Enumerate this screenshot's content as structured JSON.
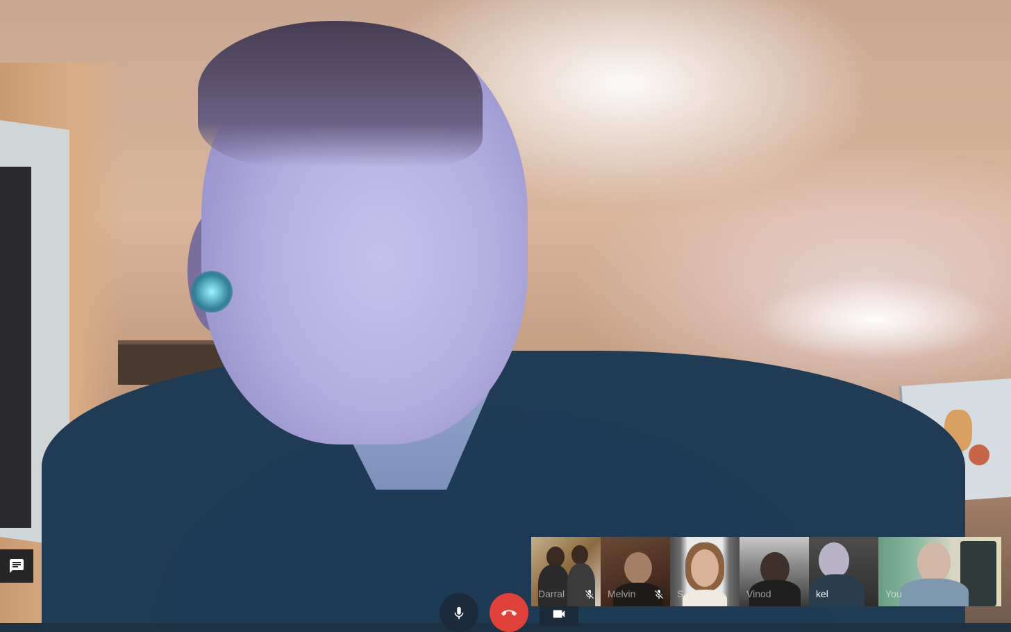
{
  "main_video": {
    "speaker": "kel"
  },
  "chat": {
    "icon": "chat-icon"
  },
  "controls": {
    "mic_icon": "microphone-icon",
    "hangup_icon": "hang-up-icon",
    "camera_icon": "video-camera-icon",
    "hangup_color": "#e0413a"
  },
  "participants": [
    {
      "name": "Darral",
      "muted": true
    },
    {
      "name": "Melvin",
      "muted": true
    },
    {
      "name": "S",
      "muted": false
    },
    {
      "name": "Vinod",
      "muted": false
    },
    {
      "name": "kel",
      "muted": false,
      "active": true
    },
    {
      "name": "You",
      "muted": false
    }
  ]
}
